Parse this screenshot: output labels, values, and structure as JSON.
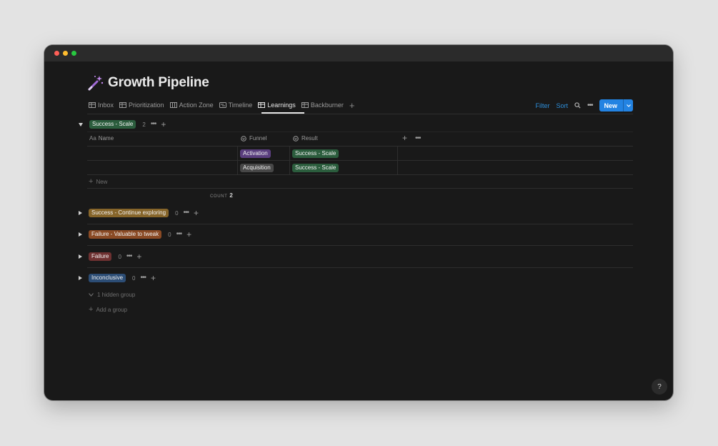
{
  "window": {
    "traffic_lights": {
      "close": "#fe5f57",
      "minimize": "#febc2e",
      "maximize": "#28c840"
    }
  },
  "page": {
    "icon": "magic-wand-icon",
    "title": "Growth Pipeline"
  },
  "tabs": [
    {
      "label": "Inbox",
      "icon": "table-icon",
      "active": false
    },
    {
      "label": "Prioritization",
      "icon": "table-icon",
      "active": false
    },
    {
      "label": "Action Zone",
      "icon": "board-icon",
      "active": false
    },
    {
      "label": "Timeline",
      "icon": "timeline-icon",
      "active": false
    },
    {
      "label": "Learnings",
      "icon": "table-icon",
      "active": true
    },
    {
      "label": "Backburner",
      "icon": "table-icon",
      "active": false
    }
  ],
  "toolbar": {
    "filter_label": "Filter",
    "sort_label": "Sort",
    "new_label": "New",
    "accent": "#2383e2"
  },
  "table": {
    "columns": {
      "name": "Name",
      "name_prefix": "Aa",
      "funnel": "Funnel",
      "result": "Result"
    },
    "rows": [
      {
        "name": "",
        "funnel": "Activation",
        "funnel_color": "#5a3e7e",
        "result": "Success - Scale",
        "result_color": "#2b5d3d"
      },
      {
        "name": "",
        "funnel": "Acquisition",
        "funnel_color": "#474747",
        "result": "Success - Scale",
        "result_color": "#2b5d3d"
      }
    ],
    "new_row_label": "New",
    "count_label": "COUNT",
    "count_value": "2"
  },
  "groups": [
    {
      "label": "Success - Scale",
      "count": "2",
      "color": "#2b5d3d",
      "expanded": true
    },
    {
      "label": "Success - Continue exploring",
      "count": "0",
      "color": "#86652a",
      "expanded": false
    },
    {
      "label": "Failure - Valuable to tweak",
      "count": "0",
      "color": "#8a4a24",
      "expanded": false
    },
    {
      "label": "Failure",
      "count": "0",
      "color": "#6e3131",
      "expanded": false
    },
    {
      "label": "Inconclusive",
      "count": "0",
      "color": "#2c4d75",
      "expanded": false
    }
  ],
  "hidden_groups_label": "1 hidden group",
  "add_group_label": "Add a group",
  "help_label": "?"
}
